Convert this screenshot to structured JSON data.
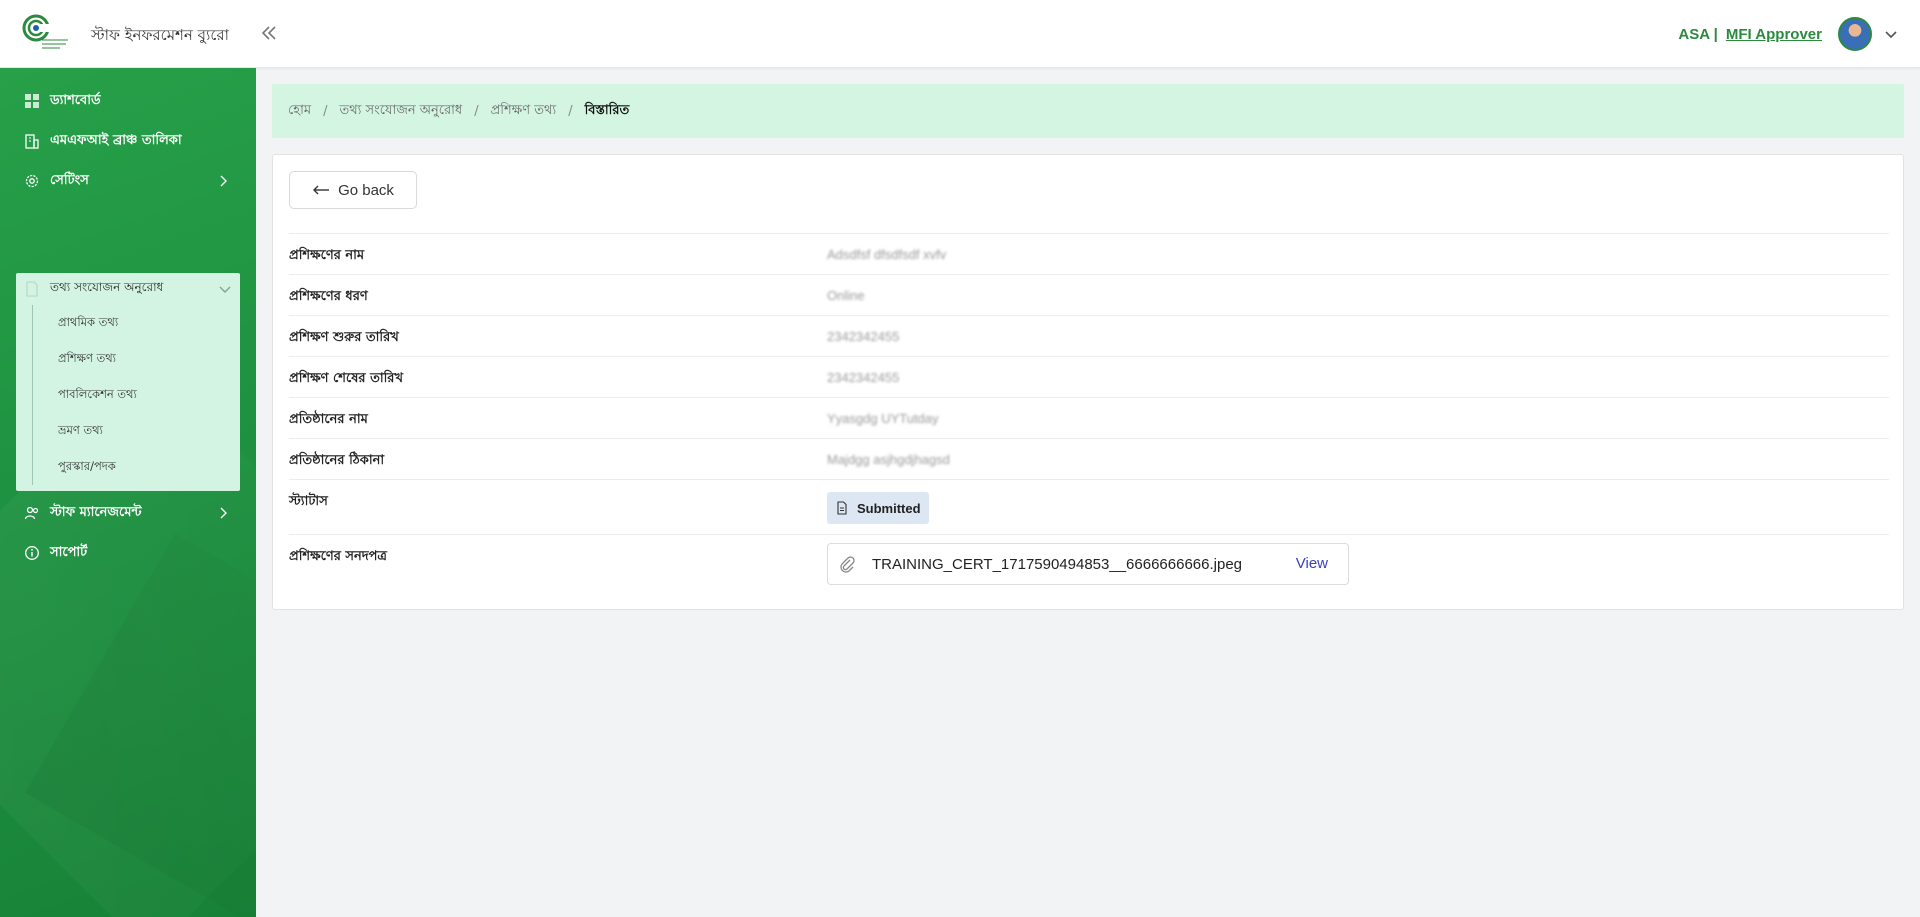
{
  "header": {
    "app_title": "স্টাফ ইনফরমেশন ব্যুরো",
    "org": "ASA |",
    "role": "MFI Approver"
  },
  "sidebar": {
    "items": [
      {
        "label": "ড্যাশবোর্ড",
        "icon": "dashboard-icon"
      },
      {
        "label": "এমএফআই ব্রাঞ্চ তালিকা",
        "icon": "building-icon"
      },
      {
        "label": "সেটিংস",
        "icon": "gear-icon"
      },
      {
        "label": "স্টাফ ম্যানেজমেন্ট",
        "icon": "users-icon"
      },
      {
        "label": "সাপোর্ট",
        "icon": "info-icon"
      }
    ],
    "group": {
      "label": "তথ্য সংযোজন অনুরোধ",
      "icon": "document-icon",
      "subitems": [
        "প্রাথমিক তথ্য",
        "প্রশিক্ষণ তথ্য",
        "পাবলিকেশন তথ্য",
        "ভ্রমণ তথ্য",
        "পুরস্কার/পদক"
      ]
    }
  },
  "breadcrumb": {
    "items": [
      "হোম",
      "তথ্য সংযোজন অনুরোধ",
      "প্রশিক্ষণ তথ্য"
    ],
    "current": "বিস্তারিত",
    "separator": "/"
  },
  "details": {
    "back_label": "Go back",
    "rows": [
      {
        "label": "প্রশিক্ষণের নাম",
        "value": "Adsdfsf dfsdfsdf xvfv"
      },
      {
        "label": "প্রশিক্ষণের ধরণ",
        "value": "Online"
      },
      {
        "label": "প্রশিক্ষণ শুরুর তারিখ",
        "value": "2342342455"
      },
      {
        "label": "প্রশিক্ষণ শেষের তারিখ",
        "value": "2342342455"
      },
      {
        "label": "প্রতিষ্ঠানের নাম",
        "value": "Yyasgdg UYTutday"
      },
      {
        "label": "প্রতিষ্ঠানের ঠিকানা",
        "value": "Majdgg asjhgdjhagsd"
      }
    ],
    "status_label": "স্ট্যাটাস",
    "status_value": "Submitted",
    "cert_label": "প্রশিক্ষণের সনদপত্র",
    "cert_file": "TRAINING_CERT_1717590494853__6666666666.jpeg",
    "cert_view": "View"
  },
  "colors": {
    "brand_green": "#2b8a3e",
    "sidebar_green": "#1f9241",
    "highlight_mint": "#d3f5e2",
    "link_blue": "#3a3fbf",
    "badge_bg": "#dde7f3"
  }
}
